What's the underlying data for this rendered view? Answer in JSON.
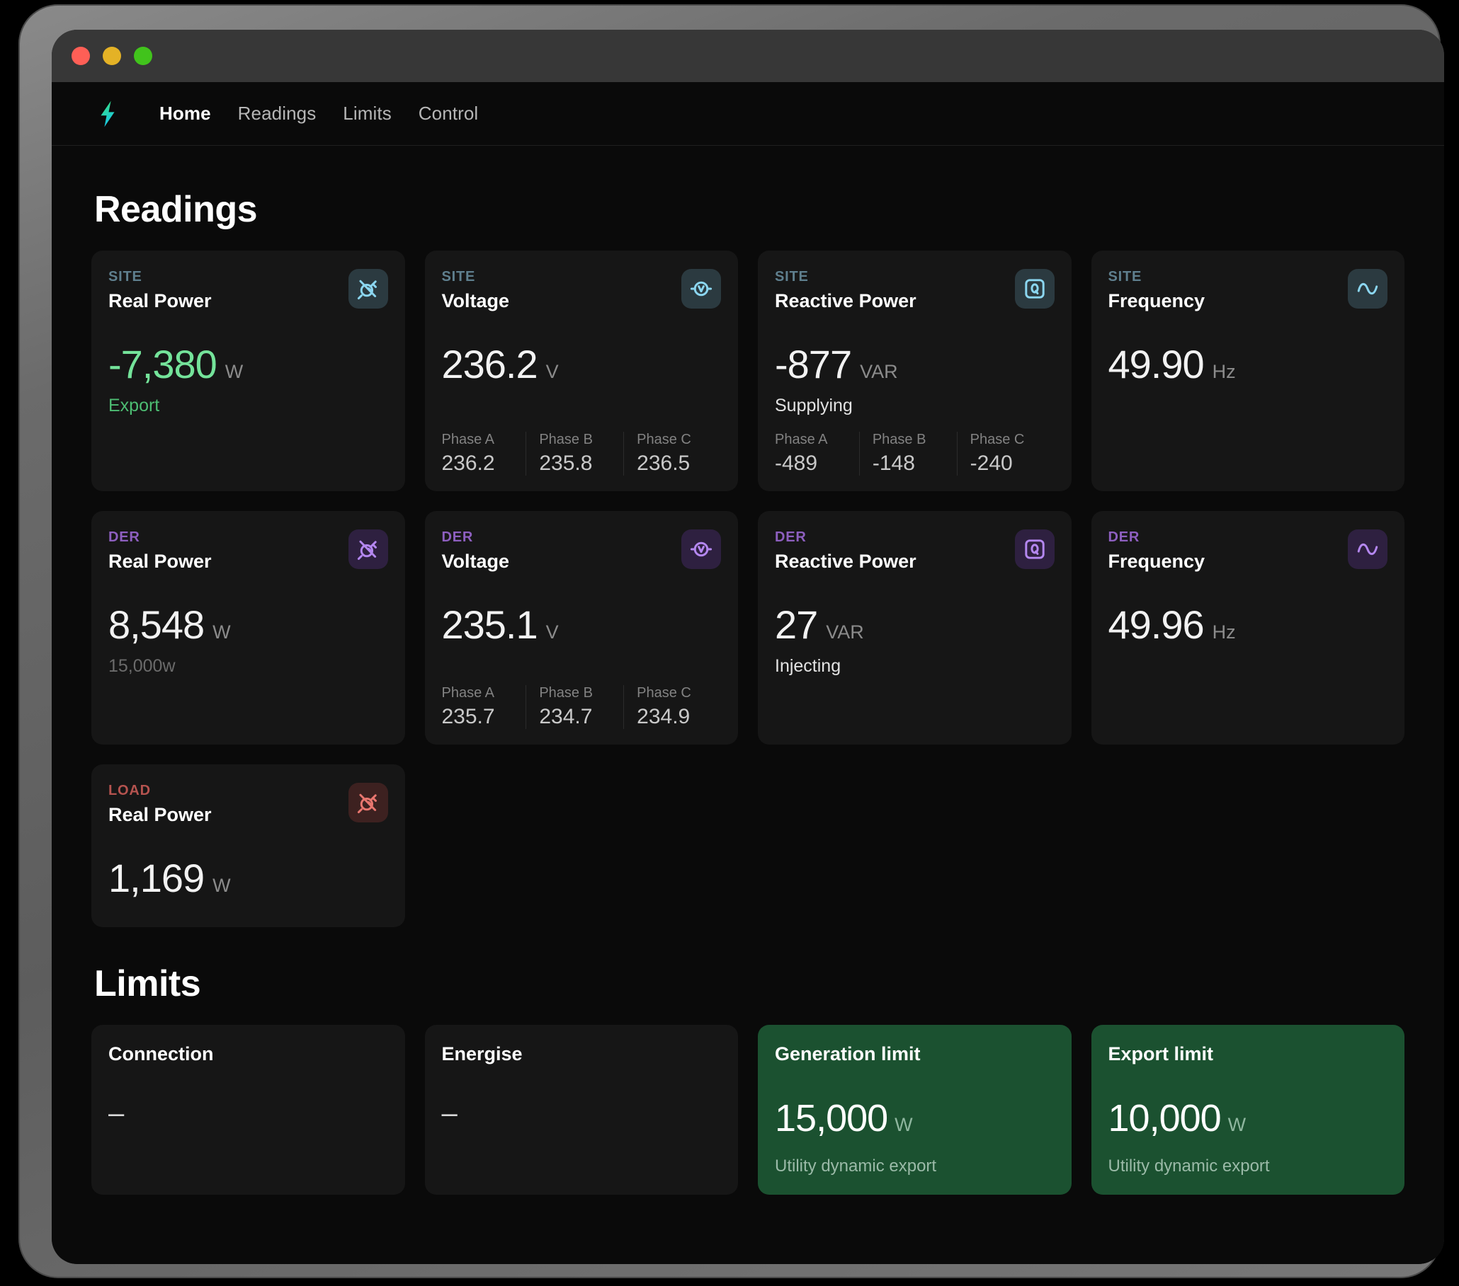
{
  "window": {
    "traffic_lights": [
      "close",
      "minimize",
      "zoom"
    ]
  },
  "nav": {
    "logo_icon": "lightning-bolt-icon",
    "items": [
      {
        "label": "Home",
        "active": true
      },
      {
        "label": "Readings",
        "active": false
      },
      {
        "label": "Limits",
        "active": false
      },
      {
        "label": "Control",
        "active": false
      }
    ]
  },
  "colors": {
    "site_accent": "#5f7f8e",
    "der_accent": "#8d5fbf",
    "load_accent": "#b5534f",
    "export_green": "#74e39a",
    "limit_card_green": "#1b5130",
    "card_bg": "#161616",
    "app_bg": "#0a0a0a"
  },
  "readings": {
    "heading": "Readings",
    "cards": [
      {
        "kicker": "SITE",
        "title": "Real Power",
        "icon": "plug-icon",
        "value": "-7,380",
        "unit": "W",
        "sub": "Export",
        "sub_style": "green",
        "value_style": "green",
        "phases": []
      },
      {
        "kicker": "SITE",
        "title": "Voltage",
        "icon": "voltmeter-icon",
        "value": "236.2",
        "unit": "V",
        "sub": "",
        "phases": [
          {
            "label": "Phase A",
            "value": "236.2"
          },
          {
            "label": "Phase B",
            "value": "235.8"
          },
          {
            "label": "Phase C",
            "value": "236.5"
          }
        ]
      },
      {
        "kicker": "SITE",
        "title": "Reactive Power",
        "icon": "q-square-icon",
        "value": "-877",
        "unit": "VAR",
        "sub": "Supplying",
        "phases": [
          {
            "label": "Phase A",
            "value": "-489"
          },
          {
            "label": "Phase B",
            "value": "-148"
          },
          {
            "label": "Phase C",
            "value": "-240"
          }
        ]
      },
      {
        "kicker": "SITE",
        "title": "Frequency",
        "icon": "sine-wave-icon",
        "value": "49.90",
        "unit": "Hz",
        "sub": "",
        "phases": []
      },
      {
        "kicker": "DER",
        "title": "Real Power",
        "icon": "plug-icon",
        "value": "8,548",
        "unit": "W",
        "sub": "15,000w",
        "sub_style": "dim",
        "phases": []
      },
      {
        "kicker": "DER",
        "title": "Voltage",
        "icon": "voltmeter-icon",
        "value": "235.1",
        "unit": "V",
        "sub": "",
        "phases": [
          {
            "label": "Phase A",
            "value": "235.7"
          },
          {
            "label": "Phase B",
            "value": "234.7"
          },
          {
            "label": "Phase C",
            "value": "234.9"
          }
        ]
      },
      {
        "kicker": "DER",
        "title": "Reactive Power",
        "icon": "q-square-icon",
        "value": "27",
        "unit": "VAR",
        "sub": "Injecting",
        "phases": []
      },
      {
        "kicker": "DER",
        "title": "Frequency",
        "icon": "sine-wave-icon",
        "value": "49.96",
        "unit": "Hz",
        "sub": "",
        "phases": []
      },
      {
        "kicker": "LOAD",
        "title": "Real Power",
        "icon": "plug-icon",
        "value": "1,169",
        "unit": "W",
        "sub": "",
        "phases": []
      }
    ]
  },
  "limits": {
    "heading": "Limits",
    "cards": [
      {
        "title": "Connection",
        "value": "–",
        "unit": "",
        "sub": "",
        "green": false
      },
      {
        "title": "Energise",
        "value": "–",
        "unit": "",
        "sub": "",
        "green": false
      },
      {
        "title": "Generation limit",
        "value": "15,000",
        "unit": "W",
        "sub": "Utility dynamic export",
        "green": true
      },
      {
        "title": "Export limit",
        "value": "10,000",
        "unit": "W",
        "sub": "Utility dynamic export",
        "green": true
      }
    ]
  }
}
